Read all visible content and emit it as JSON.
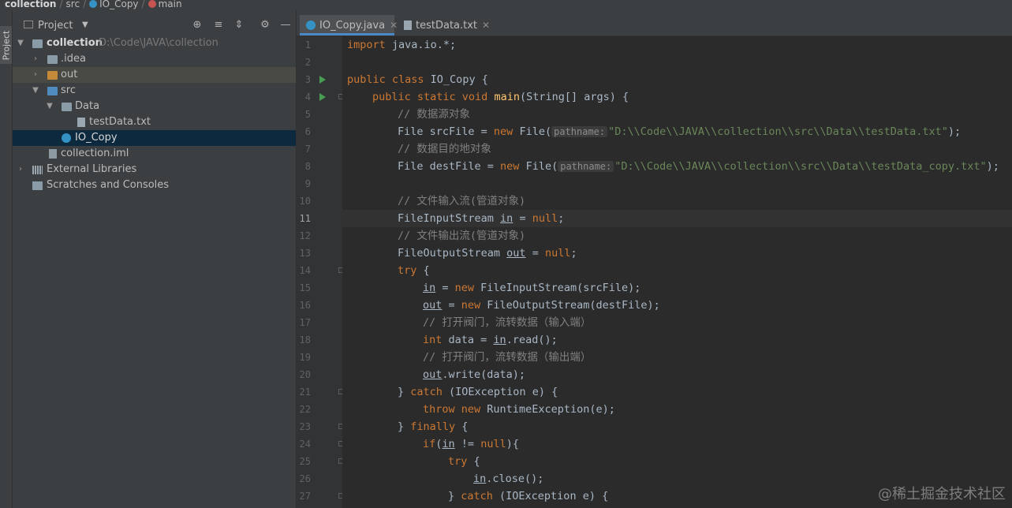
{
  "breadcrumb": {
    "project": "collection",
    "folder": "src",
    "class": "IO_Copy",
    "method": "main"
  },
  "toolstripe": {
    "project_label": "Project"
  },
  "project_panel": {
    "title": "Project",
    "tree": [
      {
        "label": "collection",
        "path": "D:\\Code\\JAVA\\collection"
      },
      {
        "label": ".idea"
      },
      {
        "label": "out"
      },
      {
        "label": "src"
      },
      {
        "label": "Data"
      },
      {
        "label": "testData.txt"
      },
      {
        "label": "IO_Copy"
      },
      {
        "label": "collection.iml"
      },
      {
        "label": "External Libraries"
      },
      {
        "label": "Scratches and Consoles"
      }
    ]
  },
  "tabs": [
    {
      "label": "IO_Copy.java",
      "active": true
    },
    {
      "label": "testData.txt",
      "active": false
    }
  ],
  "editor": {
    "current_line": 11,
    "lines": [
      {
        "n": "1"
      },
      {
        "n": "2"
      },
      {
        "n": "3"
      },
      {
        "n": "4"
      },
      {
        "n": "5"
      },
      {
        "n": "6"
      },
      {
        "n": "7"
      },
      {
        "n": "8"
      },
      {
        "n": "9"
      },
      {
        "n": "10"
      },
      {
        "n": "11"
      },
      {
        "n": "12"
      },
      {
        "n": "13"
      },
      {
        "n": "14"
      },
      {
        "n": "15"
      },
      {
        "n": "16"
      },
      {
        "n": "17"
      },
      {
        "n": "18"
      },
      {
        "n": "19"
      },
      {
        "n": "20"
      },
      {
        "n": "21"
      },
      {
        "n": "22"
      },
      {
        "n": "23"
      },
      {
        "n": "24"
      },
      {
        "n": "25"
      },
      {
        "n": "26"
      },
      {
        "n": "27"
      }
    ],
    "code": {
      "l1_kw": "import",
      "l1_rest": " java.io.*;",
      "l3_kw": "public class",
      "l3_rest": " IO_Copy {",
      "l4_kw": "public static void",
      "l4_fn": "main",
      "l4_rest": "(String[] args) {",
      "l5_cm": "// 数据源对象",
      "l6_a": "File srcFile = ",
      "l6_kw": "new",
      "l6_b": " File(",
      "l6_hint": "pathname:",
      "l6_str": "\"D:\\\\Code\\\\JAVA\\\\collection\\\\src\\\\Data\\\\testData.txt\"",
      "l6_c": ");",
      "l7_cm": "// 数据目的地对象",
      "l8_a": "File destFile = ",
      "l8_kw": "new",
      "l8_b": " File(",
      "l8_hint": "pathname:",
      "l8_str": "\"D:\\\\Code\\\\JAVA\\\\collection\\\\src\\\\Data\\\\testData_copy.txt\"",
      "l8_c": ");",
      "l10_cm": "// 文件输入流(管道对象)",
      "l11_a": "FileInputStream ",
      "l11_var": "in",
      "l11_b": " = ",
      "l11_kw": "null",
      "l11_c": ";",
      "l12_cm": "// 文件输出流(管道对象)",
      "l13_a": "FileOutputStream ",
      "l13_var": "out",
      "l13_b": " = ",
      "l13_kw": "null",
      "l13_c": ";",
      "l14_kw": "try",
      "l14_rest": " {",
      "l15_var": "in",
      "l15_a": " = ",
      "l15_kw": "new",
      "l15_b": " FileInputStream(srcFile);",
      "l16_var": "out",
      "l16_a": " = ",
      "l16_kw": "new",
      "l16_b": " FileOutputStream(destFile);",
      "l17_cm": "// 打开阀门，流转数据（输入端）",
      "l18_kw": "int",
      "l18_a": " data = ",
      "l18_var": "in",
      "l18_b": ".read();",
      "l19_cm": "// 打开阀门，流转数据（输出端）",
      "l20_var": "out",
      "l20_a": ".write(data);",
      "l21_a": "} ",
      "l21_kw": "catch",
      "l21_b": " (IOException e) {",
      "l22_kw1": "throw",
      "l22_kw2": "new",
      "l22_a": " RuntimeException(e);",
      "l23_a": "} ",
      "l23_kw": "finally",
      "l23_b": " {",
      "l24_kw": "if",
      "l24_a": "(",
      "l24_var": "in",
      "l24_b": " != ",
      "l24_kw2": "null",
      "l24_c": "){",
      "l25_kw": "try",
      "l25_a": " {",
      "l26_var": "in",
      "l26_a": ".close();",
      "l27_a": "} ",
      "l27_kw": "catch",
      "l27_b": " (IOException e) {"
    }
  },
  "watermark": "@稀土掘金技术社区",
  "colors": {
    "editor_bg": "#2b2b2b",
    "panel_bg": "#3c3f41",
    "keyword": "#cc7832",
    "comment": "#808080",
    "string": "#6a8759",
    "method": "#ffc66d",
    "selection": "#0d293e"
  }
}
